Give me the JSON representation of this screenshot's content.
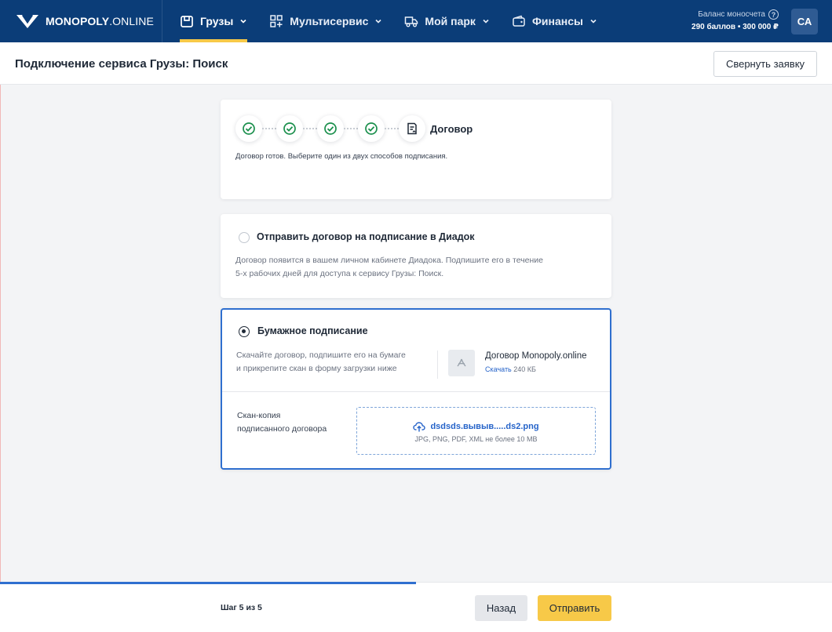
{
  "header": {
    "logo_bold": "MONOPOLY",
    "logo_light": ".ONLINE",
    "nav": [
      {
        "label": "Грузы",
        "icon": "cargo-icon",
        "active": true
      },
      {
        "label": "Мультисервис",
        "icon": "grid-plus-icon",
        "active": false
      },
      {
        "label": "Мой парк",
        "icon": "truck-icon",
        "active": false
      },
      {
        "label": "Финансы",
        "icon": "wallet-icon",
        "active": false
      }
    ],
    "balance_label": "Баланс моносчета",
    "balance_value": "290 баллов • 300 000 ₽",
    "avatar_initials": "СА"
  },
  "page": {
    "title": "Подключение сервиса Грузы: Поиск",
    "collapse_label": "Свернуть заявку"
  },
  "steps": {
    "current_label": "Договор",
    "completed_count": 4,
    "note": "Договор готов. Выберите один из двух способов подписания."
  },
  "options": {
    "diadoc": {
      "title": "Отправить договор на подписание в Диадок",
      "desc_line1": "Договор появится в вашем личном кабинете Диадока. Подпишите его в течение",
      "desc_line2": "5-х рабочих дней для доступа к сервису Грузы: Поиск.",
      "selected": false
    },
    "paper": {
      "title": "Бумажное подписание",
      "desc_line1": "Скачайте договор, подпишите его на бумаге",
      "desc_line2": "и прикрепите скан в форму загрузки ниже",
      "selected": true,
      "file_name": "Договор Monopoly.online",
      "download_label": "Скачать",
      "file_size": "240 КБ",
      "scan_label_line1": "Скан-копия",
      "scan_label_line2": "подписанного договора",
      "uploaded_file": "dsdsds.вывыв.....ds2.png",
      "upload_hint": "JPG, PNG, PDF, XML не более 10 MB"
    }
  },
  "footer": {
    "step_text": "Шаг 5 из 5",
    "progress": 0.5,
    "back_label": "Назад",
    "send_label": "Отправить"
  },
  "colors": {
    "nav_bg": "#0b3d78",
    "accent_yellow": "#f7c948",
    "accent_blue": "#2f6fcf",
    "success_green": "#1a8f4c"
  }
}
